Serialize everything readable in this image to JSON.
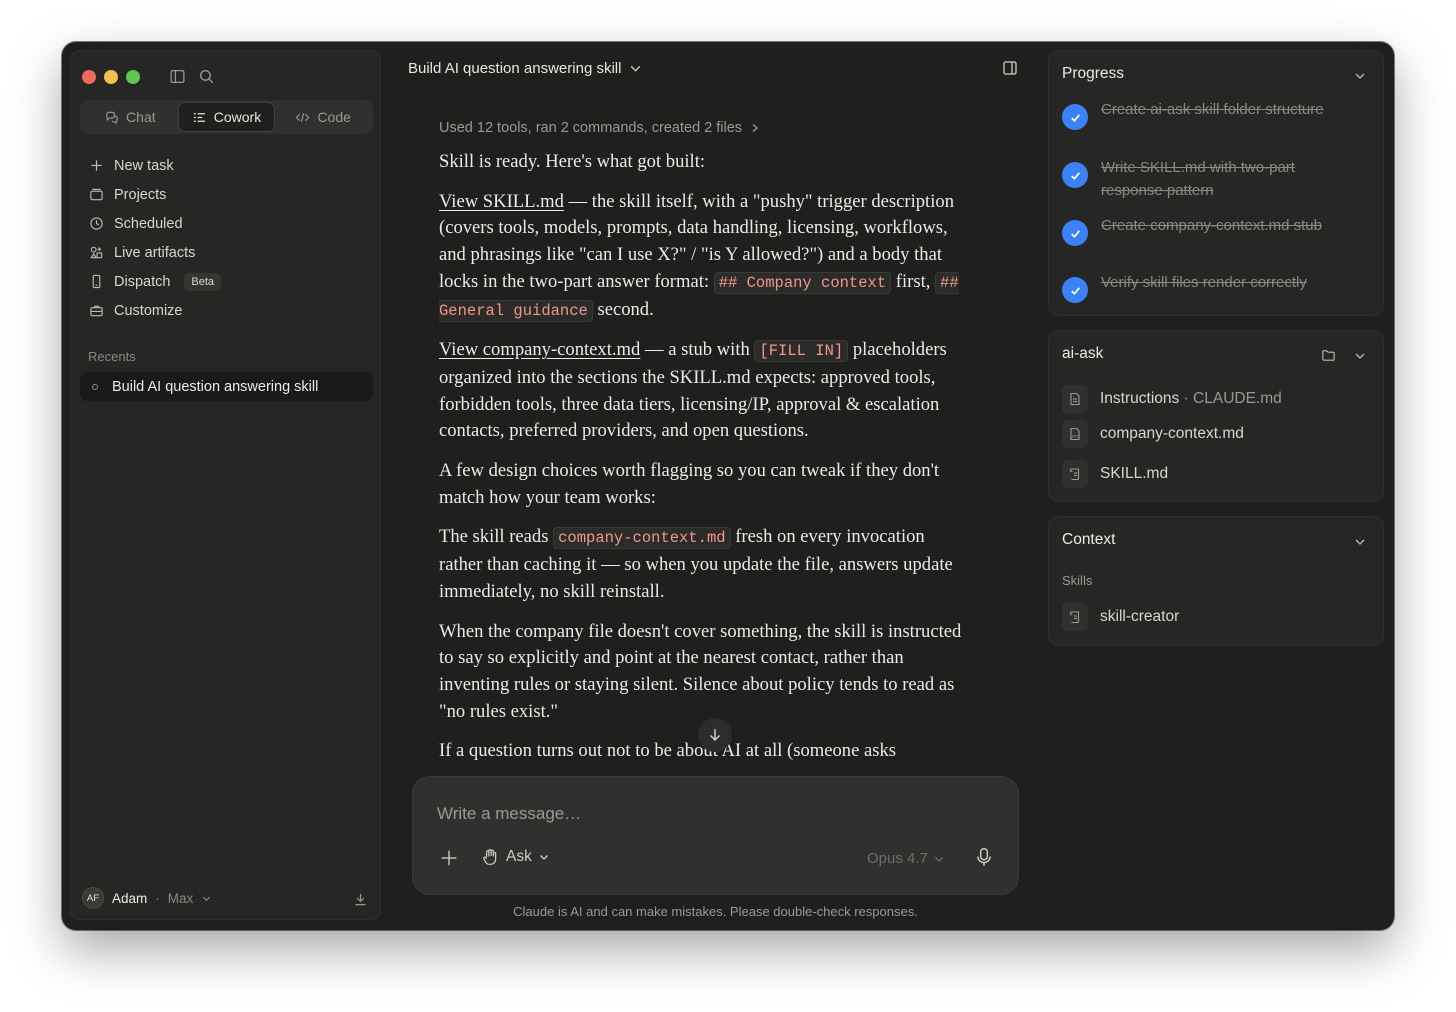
{
  "sidebar": {
    "modes": [
      {
        "label": "Chat",
        "icon": "chat-icon"
      },
      {
        "label": "Cowork",
        "icon": "cowork-icon"
      },
      {
        "label": "Code",
        "icon": "code-icon"
      }
    ],
    "nav": [
      {
        "label": "New task",
        "icon": "plus-icon"
      },
      {
        "label": "Projects",
        "icon": "folder-icon"
      },
      {
        "label": "Scheduled",
        "icon": "clock-icon"
      },
      {
        "label": "Live artifacts",
        "icon": "artifacts-icon"
      },
      {
        "label": "Dispatch",
        "icon": "phone-icon",
        "badge": "Beta"
      },
      {
        "label": "Customize",
        "icon": "briefcase-icon"
      }
    ],
    "recents_label": "Recents",
    "recents": [
      {
        "label": "Build AI question answering skill"
      }
    ],
    "user": {
      "initials": "AF",
      "name": "Adam",
      "plan": "Max"
    }
  },
  "header": {
    "title": "Build AI question answering skill"
  },
  "chat": {
    "tools_summary": "Used 12 tools, ran 2 commands, created 2 files",
    "intro": "Skill is ready. Here's what got built:",
    "p1": {
      "link": "View SKILL.md",
      "text_a": " — the skill itself, with a \"pushy\" trigger description (covers tools, models, prompts, data handling, licensing, workflows, and phrasings like \"can I use X?\" / \"is Y allowed?\") and a body that locks in the two-part answer format: ",
      "code1": "## Company context",
      "text_b": " first, ",
      "code2": "## General guidance",
      "text_c": " second."
    },
    "p2": {
      "link": "View company-context.md",
      "text_a": " — a stub with ",
      "code1": "[FILL IN]",
      "text_b": " placeholders organized into the sections the SKILL.md expects: approved tools, forbidden tools, three data tiers, licensing/IP, approval & escalation contacts, preferred providers, and open questions."
    },
    "p3": "A few design choices worth flagging so you can tweak if they don't match how your team works:",
    "p4": {
      "text_a": "The skill reads ",
      "code1": "company-context.md",
      "text_b": " fresh on every invocation rather than caching it — so when you update the file, answers update immediately, no skill reinstall."
    },
    "p5": "When the company file doesn't cover something, the skill is instructed to say so explicitly and point at the nearest contact, rather than inventing rules or staying silent. Silence about policy tends to read as \"no rules exist.\"",
    "p6": "If a question turns out not to be about AI at all (someone asks"
  },
  "composer": {
    "placeholder": "Write a message…",
    "mode": "Ask",
    "model": "Opus 4.7"
  },
  "disclaimer": "Claude is AI and can make mistakes. Please double-check responses.",
  "progress": {
    "title": "Progress",
    "steps": [
      "Create ai-ask skill folder structure",
      "Write SKILL.md with two-part response pattern",
      "Create company-context.md stub",
      "Verify skill files render correctly"
    ]
  },
  "files_panel": {
    "title": "ai-ask",
    "files": [
      {
        "name": "Instructions",
        "sub": " · CLAUDE.md"
      },
      {
        "name": "company-context.md"
      },
      {
        "name": "SKILL.md"
      }
    ]
  },
  "context_panel": {
    "title": "Context",
    "skills_label": "Skills",
    "skills": [
      "skill-creator"
    ]
  },
  "colors": {
    "accent": "#3b82f6",
    "code": "#f2978a",
    "bg": "#1f1f1e"
  }
}
